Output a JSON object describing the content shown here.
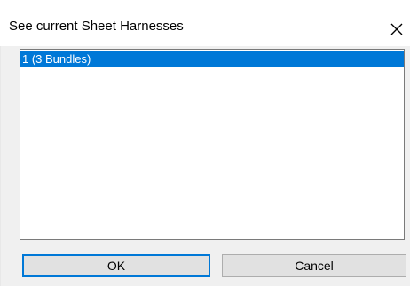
{
  "dialog": {
    "title": "See current Sheet Harnesses",
    "close_icon": "close-icon"
  },
  "list": {
    "items": [
      {
        "label": "1 (3 Bundles)",
        "selected": true
      }
    ]
  },
  "buttons": {
    "ok_label": "OK",
    "cancel_label": "Cancel"
  },
  "colors": {
    "selection": "#0078d7",
    "dialog_background": "#f0f0f0",
    "button_background": "#e1e1e1"
  }
}
